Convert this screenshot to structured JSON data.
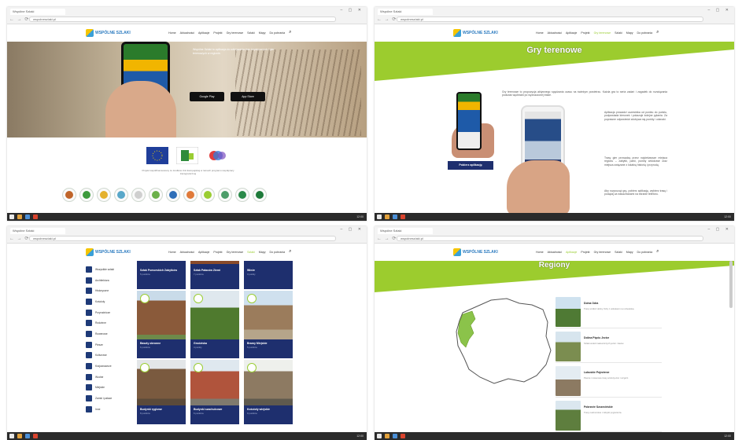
{
  "browser": {
    "tab_title": "Wspólne Szlaki",
    "address": "wspolneszlaki.pl",
    "nav_icons": "← → ⟳",
    "window_buttons": "– ▢ ✕",
    "clock": "12:00"
  },
  "site": {
    "logo_text": "WSPÓLNE SZLAKI",
    "menu": [
      "Home",
      "Aktualności",
      "Aplikacje",
      "Projekt",
      "Gry terenowe",
      "Szlaki",
      "Mapy",
      "Do pobrania"
    ],
    "search_icon": "⌕"
  },
  "panel1": {
    "hero_text": "Wspólne Szlaki to aplikacja do odkrywania tras turystycznych i gier terenowych w regionie.",
    "store_google": "Google Play",
    "store_apple": "App Store",
    "caption": "Projekt współfinansowany ze środków Unii Europejskiej w ramach programu współpracy transgranicznej",
    "partner_count_label": "Partnerzy projektu"
  },
  "panel2": {
    "title": "Gry terenowe",
    "get_app": "Pobierz aplikację",
    "para1": "Gry terenowe to propozycja aktywnego spędzania czasu na świeżym powietrzu. Każda gra to seria zadań i zagadek do rozwiązania podczas wędrówki po wyznaczonej trasie.",
    "para2": "Aplikacja prowadzi uczestnika od punktu do punktu, podpowiada kierunek i pokazuje kolejne pytania. Za poprawne odpowiedzi zdobywa się punkty i odznaki.",
    "para3": "Trasy gier prowadzą przez najciekawsze miejsca regionu – zabytki, parki, punkty widokowe oraz miejsca związane z lokalną historią i przyrodą.",
    "para4": "Aby rozpocząć grę, pobierz aplikację, wybierz trasę i podążaj za wskazówkami na ekranie telefonu."
  },
  "panel3": {
    "sidebar": [
      "Wszystkie szlaki",
      "Architektura",
      "Historyczne",
      "Kościoły",
      "Przyrodnicze",
      "Rodzinne",
      "Rowerowe",
      "Piesze",
      "Kulturowe",
      "Krajoznawcze",
      "Wodne",
      "Miejskie",
      "Zamki i pałace",
      "Inne"
    ],
    "cards": [
      {
        "title": "Szlak Pomorskich Zabytków",
        "sub": "5 punktów"
      },
      {
        "title": "Szlak Pałaców Ziemi",
        "sub": "7 punktów"
      },
      {
        "title": "Wieże",
        "sub": "3 punkty"
      },
      {
        "title": "Baszty obronne",
        "sub": "6 punktów"
      },
      {
        "title": "Grodziska",
        "sub": "4 punkty"
      },
      {
        "title": "Bramy Miejskie",
        "sub": "5 punktów"
      },
      {
        "title": "Budynki ryglowe",
        "sub": "8 punktów"
      },
      {
        "title": "Budynki szachulcowe",
        "sub": "6 punktów"
      },
      {
        "title": "Kościoły wiejskie",
        "sub": "9 punktów"
      }
    ]
  },
  "panel4": {
    "title": "Regiony",
    "regions": [
      {
        "title": "Dolna Odra",
        "desc": "Trasy wzdłuż doliny Odry z widokami na rozlewiska."
      },
      {
        "title": "Dolina Pięciu Jezior",
        "desc": "Szlaki wokół malowniczych jezior i lasów."
      },
      {
        "title": "Lubuskie Pojezierze",
        "desc": "Piesze i rowerowe trasy wśród jezior i wzgórz."
      },
      {
        "title": "Pobrzeże Szczecińskie",
        "desc": "Trasy nadmorskie i zabytki pogranicza."
      }
    ]
  }
}
